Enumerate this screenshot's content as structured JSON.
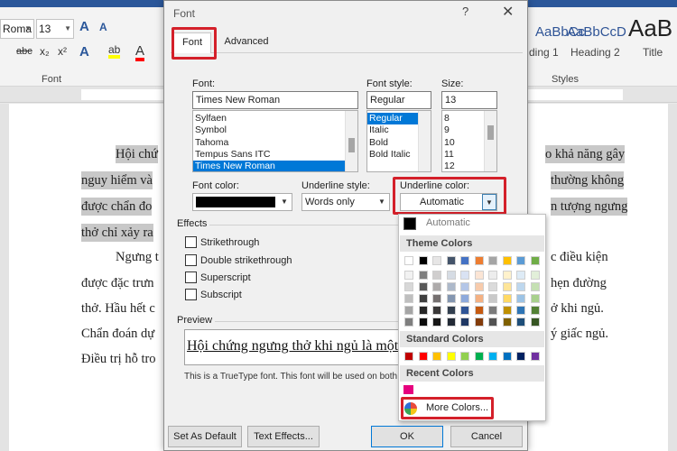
{
  "ribbon": {
    "font_name": "Roma",
    "font_size": "13",
    "group_font": "Font",
    "group_styles": "Styles",
    "styles": [
      {
        "sample": "AaBbCc",
        "name": "ding 1"
      },
      {
        "sample": "AaBbCcD",
        "name": "Heading 2"
      },
      {
        "sample": "AaB",
        "name": "Title"
      }
    ]
  },
  "document": {
    "lines": [
      {
        "text": "Hội chứ",
        "highlight": true
      },
      {
        "text": "nguy hiểm và",
        "highlight": true
      },
      {
        "text": "được chẩn đo",
        "highlight": true
      },
      {
        "text": "thở chỉ xảy ra",
        "highlight": true
      },
      {
        "text": "Ngưng t",
        "highlight": false
      },
      {
        "text": "được đặc trưn",
        "highlight": false
      },
      {
        "text": "thở. Hầu hết c",
        "highlight": false
      },
      {
        "text": "Chẩn đoán dự",
        "highlight": false
      },
      {
        "text": "Điều trị hỗ tro",
        "highlight": false
      }
    ],
    "right_lines": [
      {
        "text": "o khả năng gây",
        "highlight": true
      },
      {
        "text": "thường không",
        "highlight": true
      },
      {
        "text": "n tượng ngưng",
        "highlight": true
      },
      {
        "text": "c điều kiện",
        "highlight": false
      },
      {
        "text": "hẹn đường",
        "highlight": false
      },
      {
        "text": "ở khi ngủ.",
        "highlight": false
      },
      {
        "text": "ý giấc ngủ.",
        "highlight": false
      }
    ]
  },
  "dialog": {
    "title": "Font",
    "help": "?",
    "close": "✕",
    "tabs": [
      "Font",
      "Advanced"
    ],
    "font_label": "Font:",
    "font_value": "Times New Roman",
    "font_list": [
      "Sylfaen",
      "Symbol",
      "Tahoma",
      "Tempus Sans ITC",
      "Times New Roman"
    ],
    "style_label": "Font style:",
    "style_value": "Regular",
    "style_list": [
      "Regular",
      "Italic",
      "Bold",
      "Bold Italic"
    ],
    "size_label": "Size:",
    "size_value": "13",
    "size_list": [
      "8",
      "9",
      "10",
      "11",
      "12"
    ],
    "font_color_label": "Font color:",
    "underline_style_label": "Underline style:",
    "underline_style_value": "Words only",
    "underline_color_label": "Underline color:",
    "underline_color_value": "Automatic",
    "effects_label": "Effects",
    "effects": [
      "Strikethrough",
      "Double strikethrough",
      "Superscript",
      "Subscript"
    ],
    "preview_label": "Preview",
    "preview_text": "Hội chứng ngưng thở khi ngủ là một",
    "note": "This is a TrueType font. This font will be used on both p",
    "buttons": {
      "default": "Set As Default",
      "effects": "Text Effects...",
      "ok": "OK",
      "cancel": "Cancel"
    }
  },
  "color_popup": {
    "automatic": "Automatic",
    "theme_colors": "Theme Colors",
    "standard_colors": "Standard Colors",
    "recent_colors": "Recent Colors",
    "more_colors": "More Colors...",
    "theme_rows": [
      [
        "#ffffff",
        "#000000",
        "#e7e6e6",
        "#44546a",
        "#4472c4",
        "#ed7d31",
        "#a5a5a5",
        "#ffc000",
        "#5b9bd5",
        "#70ad47"
      ],
      [
        "#f2f2f2",
        "#7f7f7f",
        "#d0cece",
        "#d6dce4",
        "#d9e2f3",
        "#fbe5d5",
        "#ededed",
        "#fff2cc",
        "#deebf6",
        "#e2efd9"
      ],
      [
        "#d8d8d8",
        "#595959",
        "#aeabab",
        "#adb9ca",
        "#b4c6e7",
        "#f7cbac",
        "#dbdbdb",
        "#fee599",
        "#bdd7ee",
        "#c5e0b3"
      ],
      [
        "#bfbfbf",
        "#3f3f3f",
        "#757070",
        "#8496b0",
        "#8eaadb",
        "#f4b183",
        "#c9c9c9",
        "#ffd965",
        "#9cc3e5",
        "#a8d08d"
      ],
      [
        "#a5a5a5",
        "#262626",
        "#3a3838",
        "#323f4f",
        "#2f5496",
        "#c55a11",
        "#7b7b7b",
        "#bf9000",
        "#2e75b5",
        "#538135"
      ],
      [
        "#7f7f7f",
        "#0c0c0c",
        "#171616",
        "#222a35",
        "#1f3864",
        "#833c0b",
        "#525252",
        "#7f6000",
        "#1e4e79",
        "#375623"
      ]
    ],
    "standard": [
      "#c00000",
      "#ff0000",
      "#ffc000",
      "#ffff00",
      "#92d050",
      "#00b050",
      "#00b0f0",
      "#0070c0",
      "#002060",
      "#7030a0"
    ],
    "recent": [
      "#e6007e"
    ]
  }
}
